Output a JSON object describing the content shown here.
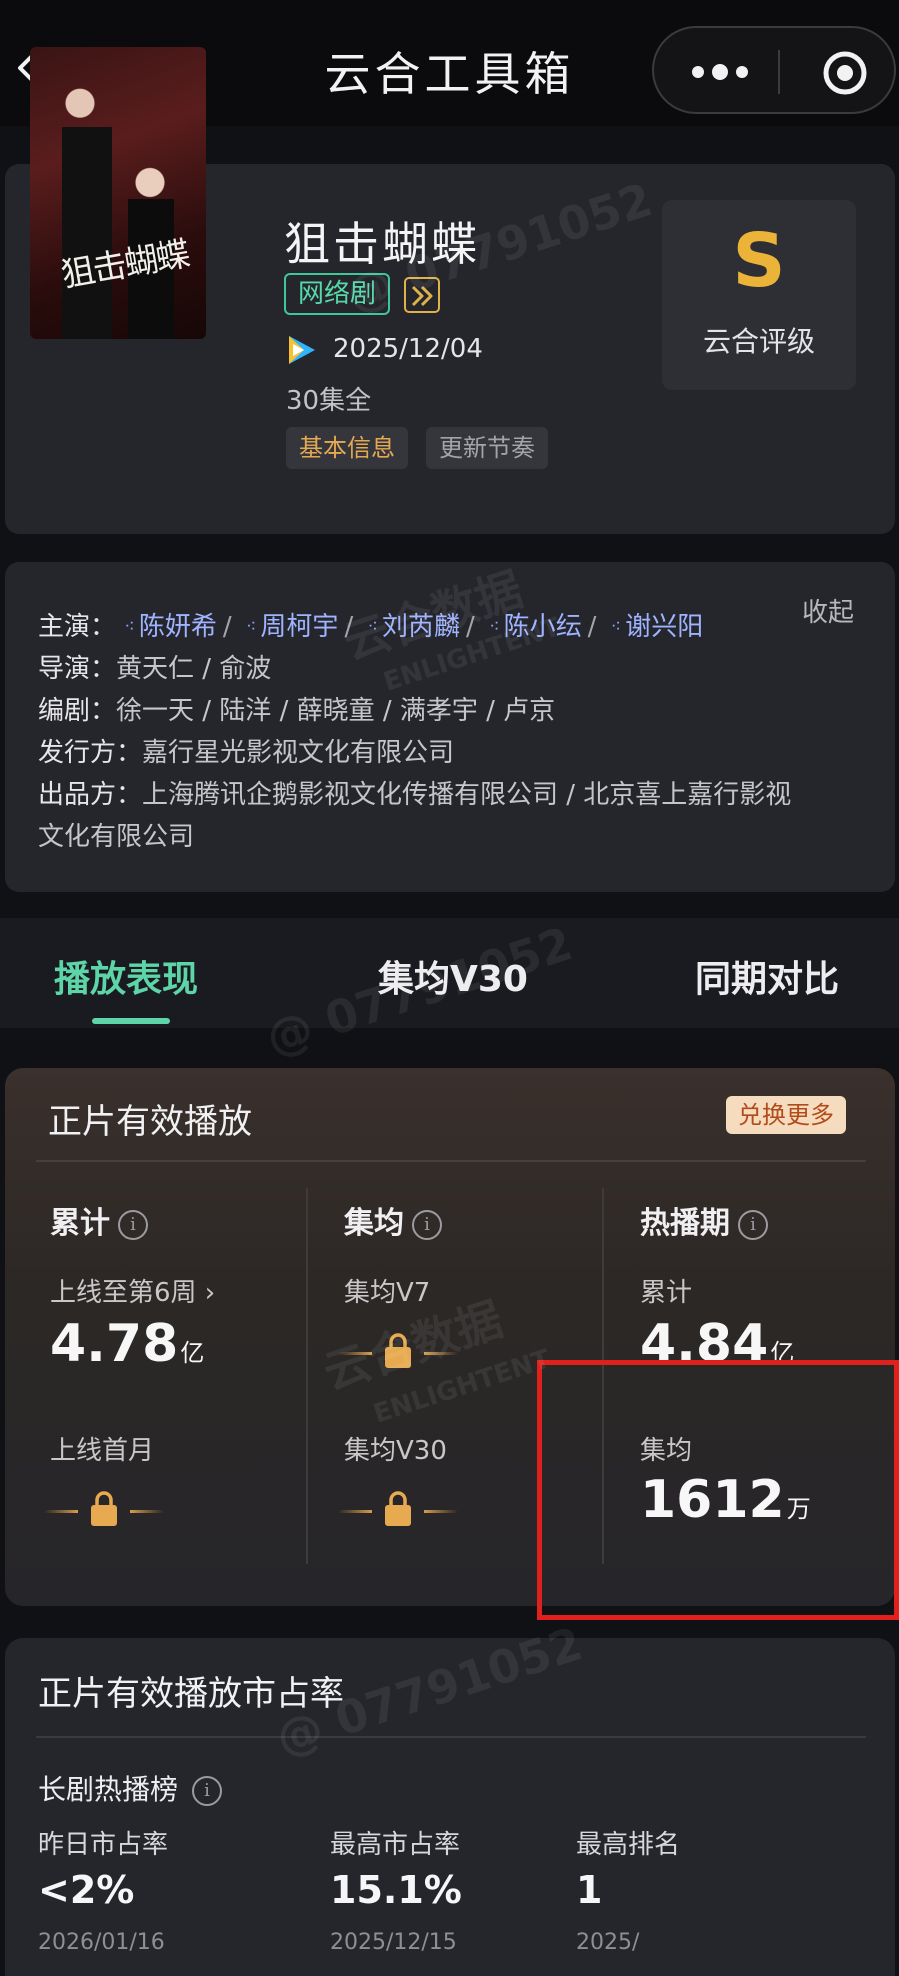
{
  "nav": {
    "title": "云合工具箱",
    "back_icon": "chevron-left-icon",
    "more_icon": "more-dots-icon",
    "close_icon": "target-circle-icon"
  },
  "drama": {
    "title": "狙击蝴蝶",
    "poster_title": "狙击蝴蝶",
    "type_tag": "网络剧",
    "release_date": "2025/12/04",
    "episodes": "30集全",
    "chips": {
      "basic_info": "基本信息",
      "update_rhythm": "更新节奏"
    },
    "rating": {
      "grade": "S",
      "label": "云合评级"
    }
  },
  "credits": {
    "cast_label": "主演：",
    "cast": [
      "陈妍希",
      "周柯宇",
      "刘芮麟",
      "陈小纭",
      "谢兴阳"
    ],
    "collapse": "收起",
    "director_label": "导演：",
    "director": "黄天仁 / 俞波",
    "writer_label": "编剧：",
    "writer": "徐一天 / 陆洋 / 薛晓童 / 满孝宇 / 卢京",
    "distributor_label": "发行方：",
    "distributor": "嘉行星光影视文化有限公司",
    "producer_label": "出品方：",
    "producer_line1": "上海腾讯企鹅影视文化传播有限公司 / 北京喜上嘉行影视",
    "producer_line2": "文化有限公司"
  },
  "tabs": [
    "播放表现",
    "集均V30",
    "同期对比"
  ],
  "playback": {
    "title": "正片有效播放",
    "exchange": "兑换更多",
    "cumulative": {
      "head": "累计",
      "label1": "上线至第6周 ›",
      "value1": "4.78",
      "unit1": "亿",
      "label2": "上线首月"
    },
    "per_episode": {
      "head": "集均",
      "label1": "集均V7",
      "label2": "集均V30"
    },
    "hot_period": {
      "head": "热播期",
      "label1": "累计",
      "value1": "4.84",
      "unit1": "亿",
      "label2": "集均",
      "value2": "1612",
      "unit2": "万"
    }
  },
  "share": {
    "title": "正片有效播放市占率",
    "rank_title": "长剧热播榜",
    "yesterday_label": "昨日市占率",
    "yesterday_value": "<2%",
    "yesterday_date": "2026/01/16",
    "max_label": "最高市占率",
    "max_value": "15.1%",
    "max_date": "2025/12/15",
    "best_rank_label": "最高排名",
    "best_rank_value": "1",
    "best_rank_date": "2025/"
  },
  "watermark": {
    "id": "@ 07791052",
    "brand": "云合数据",
    "brand_en": "ENLIGHTENT"
  },
  "colors": {
    "accent_green": "#5ed5a8",
    "rating_gold": "#ebb439",
    "highlight_red": "#e0201d",
    "cast_link": "#9fb3ff"
  }
}
